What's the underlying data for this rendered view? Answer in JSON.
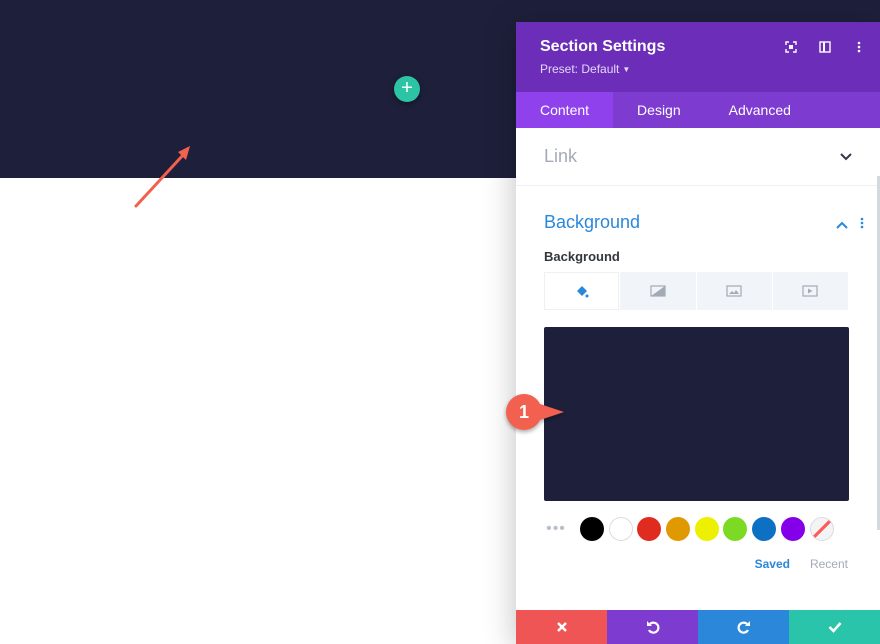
{
  "panel": {
    "title": "Section Settings",
    "preset": "Preset: Default",
    "tabs": [
      {
        "label": "Content",
        "active": true
      },
      {
        "label": "Design",
        "active": false
      },
      {
        "label": "Advanced",
        "active": false
      }
    ]
  },
  "link_toggle": {
    "label": "Link"
  },
  "background": {
    "title": "Background",
    "field_label": "Background",
    "type_icons": [
      "paint-bucket-icon",
      "gradient-icon",
      "image-icon",
      "video-icon"
    ],
    "current_color": "#1e1f3a",
    "swatches": [
      "#000000",
      "#ffffff",
      "#e02b20",
      "#e09900",
      "#edf000",
      "#7cda24",
      "#0c71c3",
      "#8300e9"
    ],
    "palette_tabs": {
      "saved": "Saved",
      "recent": "Recent"
    }
  },
  "annotation": {
    "step": "1"
  },
  "colors": {
    "header": "#6c2eb9",
    "tabs": "#7e3bd0",
    "accent": "#2b87da",
    "add_button": "#2cc4a4",
    "section_bg": "#1e1f3a"
  },
  "footer": [
    "close-icon",
    "undo-icon",
    "redo-icon",
    "check-icon"
  ]
}
